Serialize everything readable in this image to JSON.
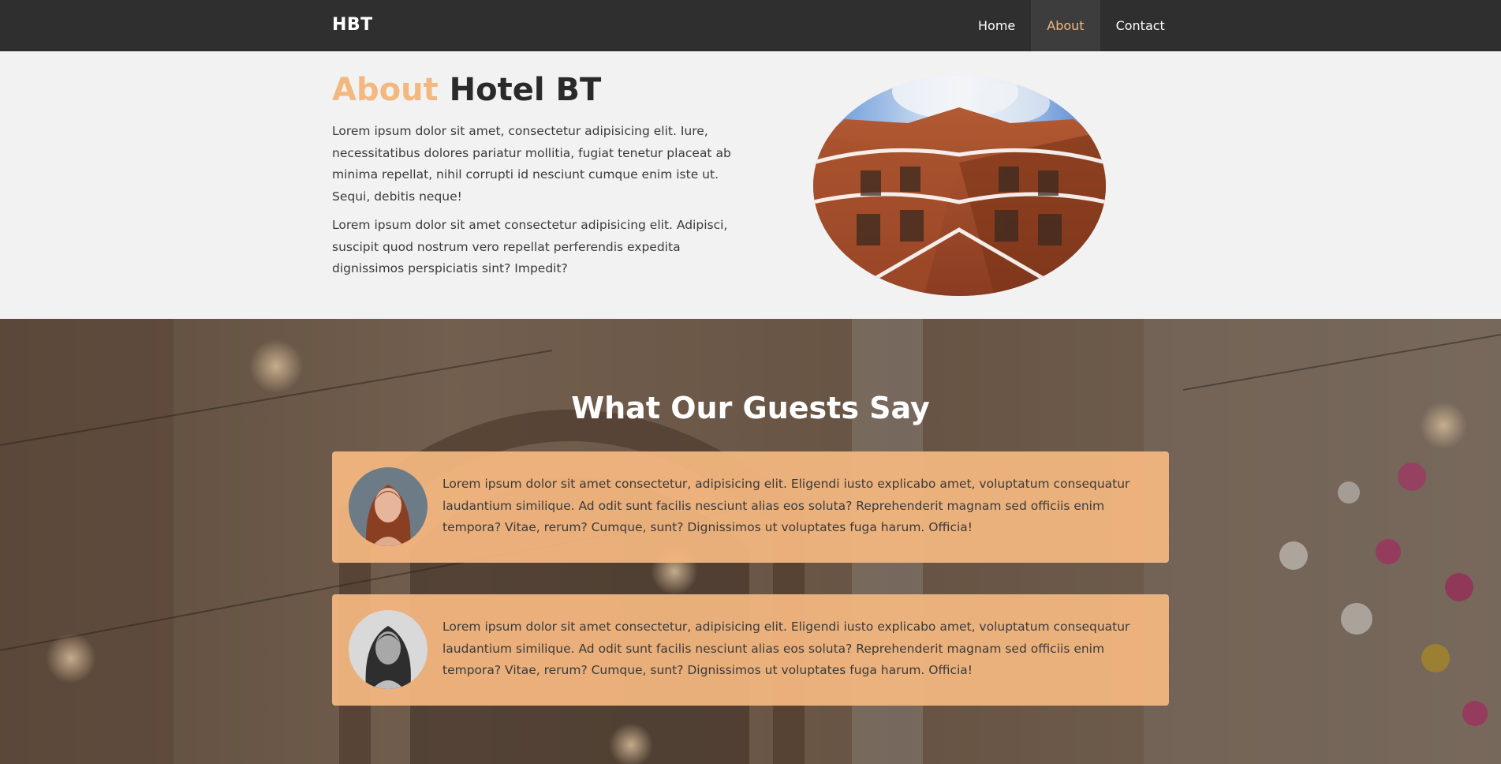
{
  "navbar": {
    "brand": "HBT",
    "items": [
      {
        "label": "Home",
        "active": false
      },
      {
        "label": "About",
        "active": true
      },
      {
        "label": "Contact",
        "active": false
      }
    ]
  },
  "about": {
    "title_accent": "About",
    "title_rest": "Hotel BT",
    "paragraphs": [
      "Lorem ipsum dolor sit amet, consectetur adipisicing elit. Iure, necessitatibus dolores pariatur mollitia, fugiat tenetur placeat ab minima repellat, nihil corrupti id nesciunt cumque enim iste ut. Sequi, debitis neque!",
      "Lorem ipsum dolor sit amet consectetur adipisicing elit. Adipisci, suscipit quod nostrum vero repellat perferendis expedita dignissimos perspiciatis sint? Impedit?"
    ]
  },
  "guests": {
    "title": "What Our Guests Say",
    "testimonials": [
      {
        "text": "Lorem ipsum dolor sit amet consectetur, adipisicing elit. Eligendi iusto explicabo amet, voluptatum consequatur laudantium similique. Ad odit sunt facilis nesciunt alias eos soluta? Reprehenderit magnam sed officiis enim tempora? Vitae, rerum? Cumque, sunt? Dignissimos ut voluptates fuga harum. Officia!"
      },
      {
        "text": "Lorem ipsum dolor sit amet consectetur, adipisicing elit. Eligendi iusto explicabo amet, voluptatum consequatur laudantium similique. Ad odit sunt facilis nesciunt alias eos soluta? Reprehenderit magnam sed officiis enim tempora? Vitae, rerum? Cumque, sunt? Dignissimos ut voluptates fuga harum. Officia!"
      }
    ]
  },
  "colors": {
    "navbar_bg": "#2f2f2f",
    "accent": "#f2b880",
    "card_bg": "#f5b880",
    "page_bg": "#f2f2f2"
  }
}
